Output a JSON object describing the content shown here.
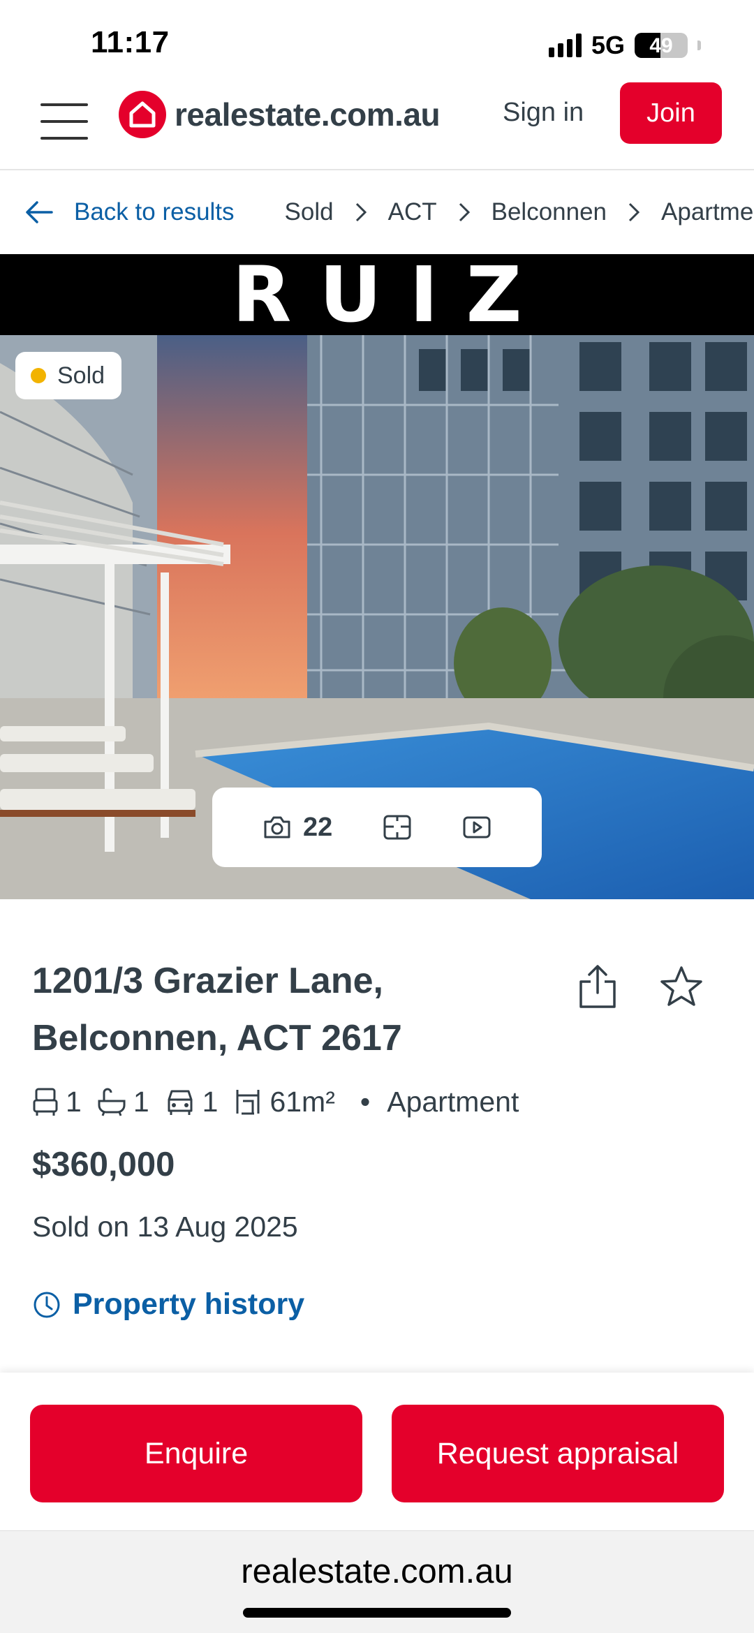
{
  "status_bar": {
    "time": "11:17",
    "network": "5G",
    "battery": "49"
  },
  "header": {
    "logo_text": "realestate.com.au",
    "sign_in": "Sign in",
    "join": "Join"
  },
  "breadcrumb": {
    "back": "Back to results",
    "items": [
      "Sold",
      "ACT",
      "Belconnen",
      "Apartment"
    ]
  },
  "hero": {
    "agency": "RUIZ",
    "status_badge": "Sold",
    "photo_count": "22"
  },
  "listing": {
    "address_line1": "1201/3 Grazier Lane,",
    "address_line2": "Belconnen, ACT 2617",
    "bedrooms": "1",
    "bathrooms": "1",
    "parking": "1",
    "land_size": "61m²",
    "property_type": "Apartment",
    "price": "$360,000",
    "sold_date": "Sold on 13 Aug 2025",
    "history_link": "Property history"
  },
  "actions": {
    "enquire": "Enquire",
    "appraisal": "Request appraisal"
  },
  "browser": {
    "url": "realestate.com.au"
  },
  "colors": {
    "brand": "#e4002b",
    "link": "#0b5fa5",
    "text": "#333f48",
    "sold_dot": "#f2b300"
  }
}
